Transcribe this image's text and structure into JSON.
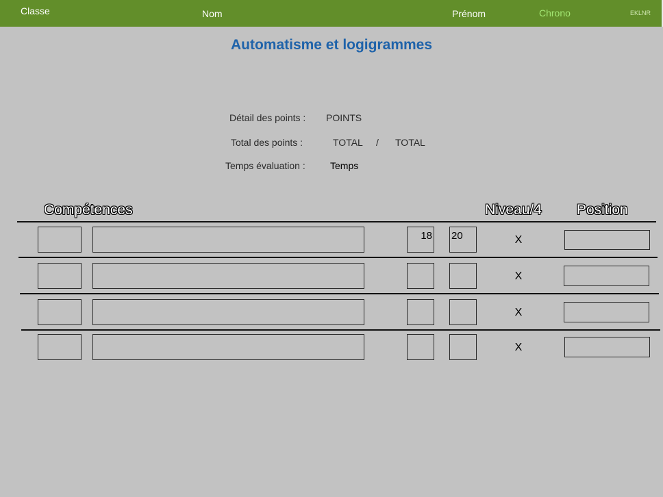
{
  "header": {
    "classe": "Classe",
    "nom": "Nom",
    "prenom": "Prénom",
    "chrono": "Chrono",
    "code": "EKLNR"
  },
  "title": "Automatisme et logigrammes",
  "summary": {
    "detail_label": "Détail des points :",
    "detail_value": "POINTS",
    "total_label": "Total des points :",
    "total_value": "TOTAL",
    "total_sep": "/",
    "total_max": "TOTAL",
    "temps_label": "Temps évaluation :",
    "temps_value": "Temps"
  },
  "table": {
    "col_competences": "Compétences",
    "col_niveau": "Niveau/4",
    "col_position": "Position",
    "rows": [
      {
        "code": "",
        "description": "",
        "score": "18",
        "max": "20",
        "niveau": "X",
        "position": ""
      },
      {
        "code": "",
        "description": "",
        "score": "",
        "max": "",
        "niveau": "X",
        "position": ""
      },
      {
        "code": "",
        "description": "",
        "score": "",
        "max": "",
        "niveau": "X",
        "position": ""
      },
      {
        "code": "",
        "description": "",
        "score": "",
        "max": "",
        "niveau": "X",
        "position": ""
      }
    ]
  }
}
